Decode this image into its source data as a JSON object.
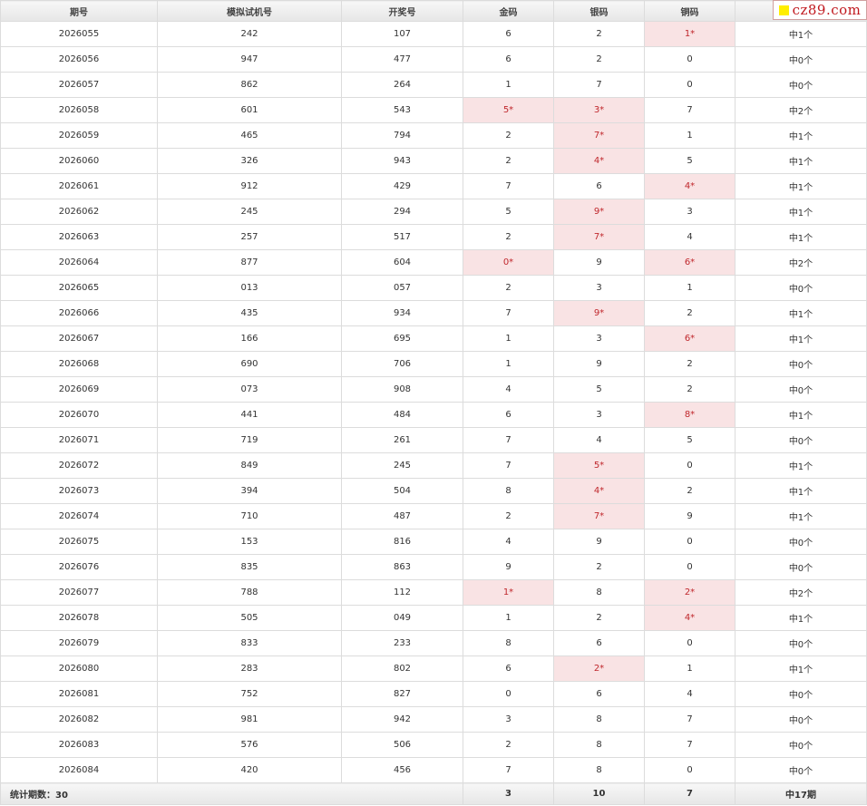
{
  "headers": [
    "期号",
    "模拟试机号",
    "开奖号",
    "金码",
    "银码",
    "铜码",
    ""
  ],
  "watermark": "cz89.com",
  "rows": [
    {
      "period": "2026055",
      "sim": "242",
      "draw": "107",
      "gold": "6",
      "gold_hit": false,
      "silver": "2",
      "silver_hit": false,
      "bronze": "1*",
      "bronze_hit": true,
      "result": "中1个"
    },
    {
      "period": "2026056",
      "sim": "947",
      "draw": "477",
      "gold": "6",
      "gold_hit": false,
      "silver": "2",
      "silver_hit": false,
      "bronze": "0",
      "bronze_hit": false,
      "result": "中0个"
    },
    {
      "period": "2026057",
      "sim": "862",
      "draw": "264",
      "gold": "1",
      "gold_hit": false,
      "silver": "7",
      "silver_hit": false,
      "bronze": "0",
      "bronze_hit": false,
      "result": "中0个"
    },
    {
      "period": "2026058",
      "sim": "601",
      "draw": "543",
      "gold": "5*",
      "gold_hit": true,
      "silver": "3*",
      "silver_hit": true,
      "bronze": "7",
      "bronze_hit": false,
      "result": "中2个"
    },
    {
      "period": "2026059",
      "sim": "465",
      "draw": "794",
      "gold": "2",
      "gold_hit": false,
      "silver": "7*",
      "silver_hit": true,
      "bronze": "1",
      "bronze_hit": false,
      "result": "中1个"
    },
    {
      "period": "2026060",
      "sim": "326",
      "draw": "943",
      "gold": "2",
      "gold_hit": false,
      "silver": "4*",
      "silver_hit": true,
      "bronze": "5",
      "bronze_hit": false,
      "result": "中1个"
    },
    {
      "period": "2026061",
      "sim": "912",
      "draw": "429",
      "gold": "7",
      "gold_hit": false,
      "silver": "6",
      "silver_hit": false,
      "bronze": "4*",
      "bronze_hit": true,
      "result": "中1个"
    },
    {
      "period": "2026062",
      "sim": "245",
      "draw": "294",
      "gold": "5",
      "gold_hit": false,
      "silver": "9*",
      "silver_hit": true,
      "bronze": "3",
      "bronze_hit": false,
      "result": "中1个"
    },
    {
      "period": "2026063",
      "sim": "257",
      "draw": "517",
      "gold": "2",
      "gold_hit": false,
      "silver": "7*",
      "silver_hit": true,
      "bronze": "4",
      "bronze_hit": false,
      "result": "中1个"
    },
    {
      "period": "2026064",
      "sim": "877",
      "draw": "604",
      "gold": "0*",
      "gold_hit": true,
      "silver": "9",
      "silver_hit": false,
      "bronze": "6*",
      "bronze_hit": true,
      "result": "中2个"
    },
    {
      "period": "2026065",
      "sim": "013",
      "draw": "057",
      "gold": "2",
      "gold_hit": false,
      "silver": "3",
      "silver_hit": false,
      "bronze": "1",
      "bronze_hit": false,
      "result": "中0个"
    },
    {
      "period": "2026066",
      "sim": "435",
      "draw": "934",
      "gold": "7",
      "gold_hit": false,
      "silver": "9*",
      "silver_hit": true,
      "bronze": "2",
      "bronze_hit": false,
      "result": "中1个"
    },
    {
      "period": "2026067",
      "sim": "166",
      "draw": "695",
      "gold": "1",
      "gold_hit": false,
      "silver": "3",
      "silver_hit": false,
      "bronze": "6*",
      "bronze_hit": true,
      "result": "中1个"
    },
    {
      "period": "2026068",
      "sim": "690",
      "draw": "706",
      "gold": "1",
      "gold_hit": false,
      "silver": "9",
      "silver_hit": false,
      "bronze": "2",
      "bronze_hit": false,
      "result": "中0个"
    },
    {
      "period": "2026069",
      "sim": "073",
      "draw": "908",
      "gold": "4",
      "gold_hit": false,
      "silver": "5",
      "silver_hit": false,
      "bronze": "2",
      "bronze_hit": false,
      "result": "中0个"
    },
    {
      "period": "2026070",
      "sim": "441",
      "draw": "484",
      "gold": "6",
      "gold_hit": false,
      "silver": "3",
      "silver_hit": false,
      "bronze": "8*",
      "bronze_hit": true,
      "result": "中1个"
    },
    {
      "period": "2026071",
      "sim": "719",
      "draw": "261",
      "gold": "7",
      "gold_hit": false,
      "silver": "4",
      "silver_hit": false,
      "bronze": "5",
      "bronze_hit": false,
      "result": "中0个"
    },
    {
      "period": "2026072",
      "sim": "849",
      "draw": "245",
      "gold": "7",
      "gold_hit": false,
      "silver": "5*",
      "silver_hit": true,
      "bronze": "0",
      "bronze_hit": false,
      "result": "中1个"
    },
    {
      "period": "2026073",
      "sim": "394",
      "draw": "504",
      "gold": "8",
      "gold_hit": false,
      "silver": "4*",
      "silver_hit": true,
      "bronze": "2",
      "bronze_hit": false,
      "result": "中1个"
    },
    {
      "period": "2026074",
      "sim": "710",
      "draw": "487",
      "gold": "2",
      "gold_hit": false,
      "silver": "7*",
      "silver_hit": true,
      "bronze": "9",
      "bronze_hit": false,
      "result": "中1个"
    },
    {
      "period": "2026075",
      "sim": "153",
      "draw": "816",
      "gold": "4",
      "gold_hit": false,
      "silver": "9",
      "silver_hit": false,
      "bronze": "0",
      "bronze_hit": false,
      "result": "中0个"
    },
    {
      "period": "2026076",
      "sim": "835",
      "draw": "863",
      "gold": "9",
      "gold_hit": false,
      "silver": "2",
      "silver_hit": false,
      "bronze": "0",
      "bronze_hit": false,
      "result": "中0个"
    },
    {
      "period": "2026077",
      "sim": "788",
      "draw": "112",
      "gold": "1*",
      "gold_hit": true,
      "silver": "8",
      "silver_hit": false,
      "bronze": "2*",
      "bronze_hit": true,
      "result": "中2个"
    },
    {
      "period": "2026078",
      "sim": "505",
      "draw": "049",
      "gold": "1",
      "gold_hit": false,
      "silver": "2",
      "silver_hit": false,
      "bronze": "4*",
      "bronze_hit": true,
      "result": "中1个"
    },
    {
      "period": "2026079",
      "sim": "833",
      "draw": "233",
      "gold": "8",
      "gold_hit": false,
      "silver": "6",
      "silver_hit": false,
      "bronze": "0",
      "bronze_hit": false,
      "result": "中0个"
    },
    {
      "period": "2026080",
      "sim": "283",
      "draw": "802",
      "gold": "6",
      "gold_hit": false,
      "silver": "2*",
      "silver_hit": true,
      "bronze": "1",
      "bronze_hit": false,
      "result": "中1个"
    },
    {
      "period": "2026081",
      "sim": "752",
      "draw": "827",
      "gold": "0",
      "gold_hit": false,
      "silver": "6",
      "silver_hit": false,
      "bronze": "4",
      "bronze_hit": false,
      "result": "中0个"
    },
    {
      "period": "2026082",
      "sim": "981",
      "draw": "942",
      "gold": "3",
      "gold_hit": false,
      "silver": "8",
      "silver_hit": false,
      "bronze": "7",
      "bronze_hit": false,
      "result": "中0个"
    },
    {
      "period": "2026083",
      "sim": "576",
      "draw": "506",
      "gold": "2",
      "gold_hit": false,
      "silver": "8",
      "silver_hit": false,
      "bronze": "7",
      "bronze_hit": false,
      "result": "中0个"
    },
    {
      "period": "2026084",
      "sim": "420",
      "draw": "456",
      "gold": "7",
      "gold_hit": false,
      "silver": "8",
      "silver_hit": false,
      "bronze": "0",
      "bronze_hit": false,
      "result": "中0个"
    }
  ],
  "footer": {
    "label": "统计期数：30",
    "gold_total": "3",
    "silver_total": "10",
    "bronze_total": "7",
    "result_total": "中17期"
  },
  "colors": {
    "hit_background": "#f9e3e4",
    "hit_text": "#c0282d",
    "watermark_text": "#c0171d",
    "watermark_square": "#ffee00"
  }
}
